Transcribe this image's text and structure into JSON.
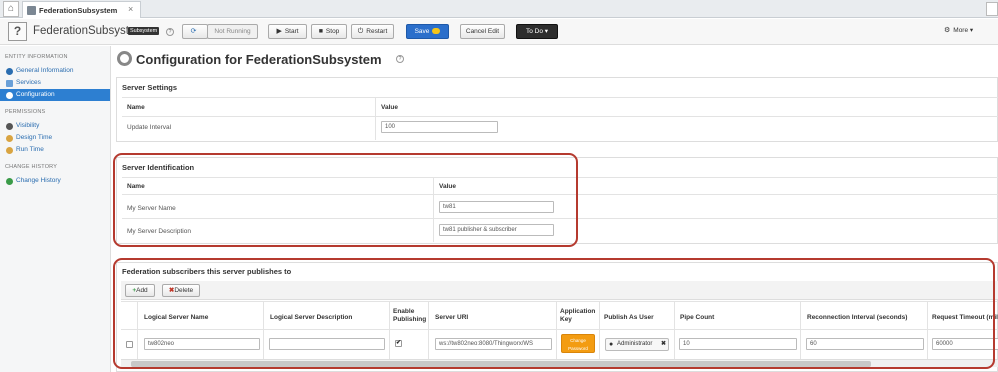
{
  "tabs": {
    "home_icon": "home-icon",
    "active_label": "FederationSubsystem",
    "close": "×"
  },
  "toolbar": {
    "entity_name": "FederationSubsystem",
    "entity_type_badge": "Subsystem",
    "help": "?",
    "state_label": "Not Running",
    "start_label": "Start",
    "stop_label": "Stop",
    "restart_label": "Restart",
    "save_label": "Save",
    "cancel_label": "Cancel Edit",
    "todo_label": "To Do",
    "more_label": "More"
  },
  "sidebar": {
    "entity_info_header": "ENTITY INFORMATION",
    "general_info": "General Information",
    "services": "Services",
    "configuration": "Configuration",
    "permissions_header": "PERMISSIONS",
    "visibility": "Visibility",
    "design_time": "Design Time",
    "run_time": "Run Time",
    "change_history_header": "CHANGE HISTORY",
    "change_history": "Change History"
  },
  "main": {
    "title": "Configuration for FederationSubsystem",
    "help": "?",
    "server_settings": {
      "title": "Server Settings",
      "col_name": "Name",
      "col_value": "Value",
      "rows": [
        {
          "name": "Update Interval",
          "value": "100"
        }
      ]
    },
    "server_identification": {
      "title": "Server Identification",
      "col_name": "Name",
      "col_value": "Value",
      "rows": [
        {
          "name": "My Server Name",
          "value": "tw81"
        },
        {
          "name": "My Server Description",
          "value": "tw81 publisher & subscriber"
        }
      ]
    },
    "subscribers": {
      "title": "Federation subscribers this server publishes to",
      "add_label": "Add",
      "delete_label": "Delete",
      "columns": [
        "Logical Server Name",
        "Logical Server Description",
        "Enable Publishing",
        "Server URI",
        "Application Key",
        "Publish As User",
        "Pipe Count",
        "Reconnection Interval (seconds)",
        "Request Timeout (mil"
      ],
      "rows": [
        {
          "logical_server_name": "tw802neo",
          "logical_server_description": "",
          "enable_publishing": true,
          "server_uri": "ws://tw802neo:8080/Thingworx/WS",
          "app_key_button": "Change Password",
          "publish_as_user": "Administrator",
          "pipe_count": "10",
          "reconnection_interval": "60",
          "request_timeout": "60000"
        }
      ]
    }
  },
  "colors": {
    "accent": "#2d7fd1",
    "highlight_border": "#b53a2f",
    "app_key_button": "#f39c12",
    "todo_button": "#2d2d2d"
  }
}
